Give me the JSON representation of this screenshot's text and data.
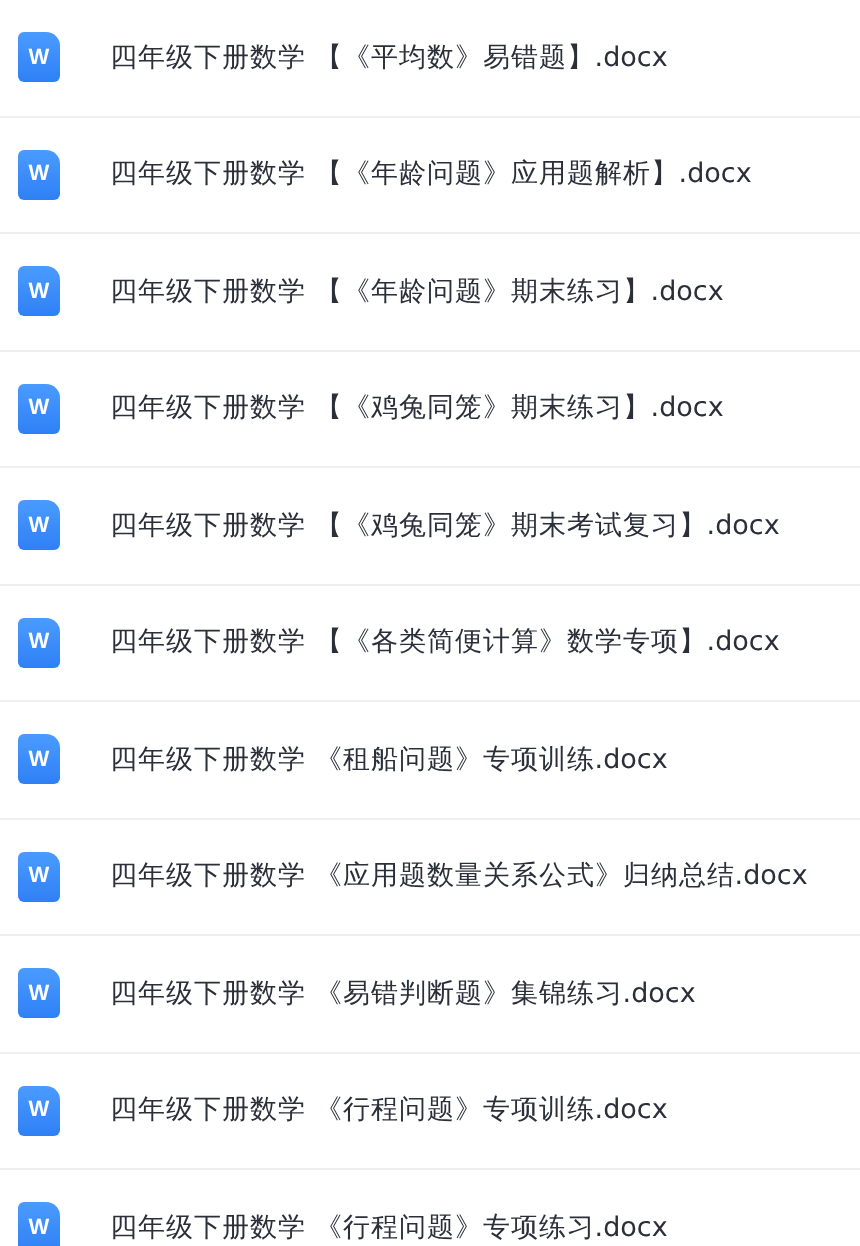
{
  "files": [
    {
      "icon_letter": "W",
      "name": "四年级下册数学 【《平均数》易错题】.docx"
    },
    {
      "icon_letter": "W",
      "name": "四年级下册数学 【《年龄问题》应用题解析】.docx"
    },
    {
      "icon_letter": "W",
      "name": "四年级下册数学 【《年龄问题》期末练习】.docx"
    },
    {
      "icon_letter": "W",
      "name": "四年级下册数学 【《鸡兔同笼》期末练习】.docx"
    },
    {
      "icon_letter": "W",
      "name": "四年级下册数学 【《鸡兔同笼》期末考试复习】.docx"
    },
    {
      "icon_letter": "W",
      "name": "四年级下册数学 【《各类简便计算》数学专项】.docx"
    },
    {
      "icon_letter": "W",
      "name": "四年级下册数学 《租船问题》专项训练.docx"
    },
    {
      "icon_letter": "W",
      "name": "四年级下册数学 《应用题数量关系公式》归纳总结.docx"
    },
    {
      "icon_letter": "W",
      "name": "四年级下册数学 《易错判断题》集锦练习.docx"
    },
    {
      "icon_letter": "W",
      "name": "四年级下册数学 《行程问题》专项训练.docx"
    },
    {
      "icon_letter": "W",
      "name": "四年级下册数学 《行程问题》专项练习.docx"
    }
  ]
}
